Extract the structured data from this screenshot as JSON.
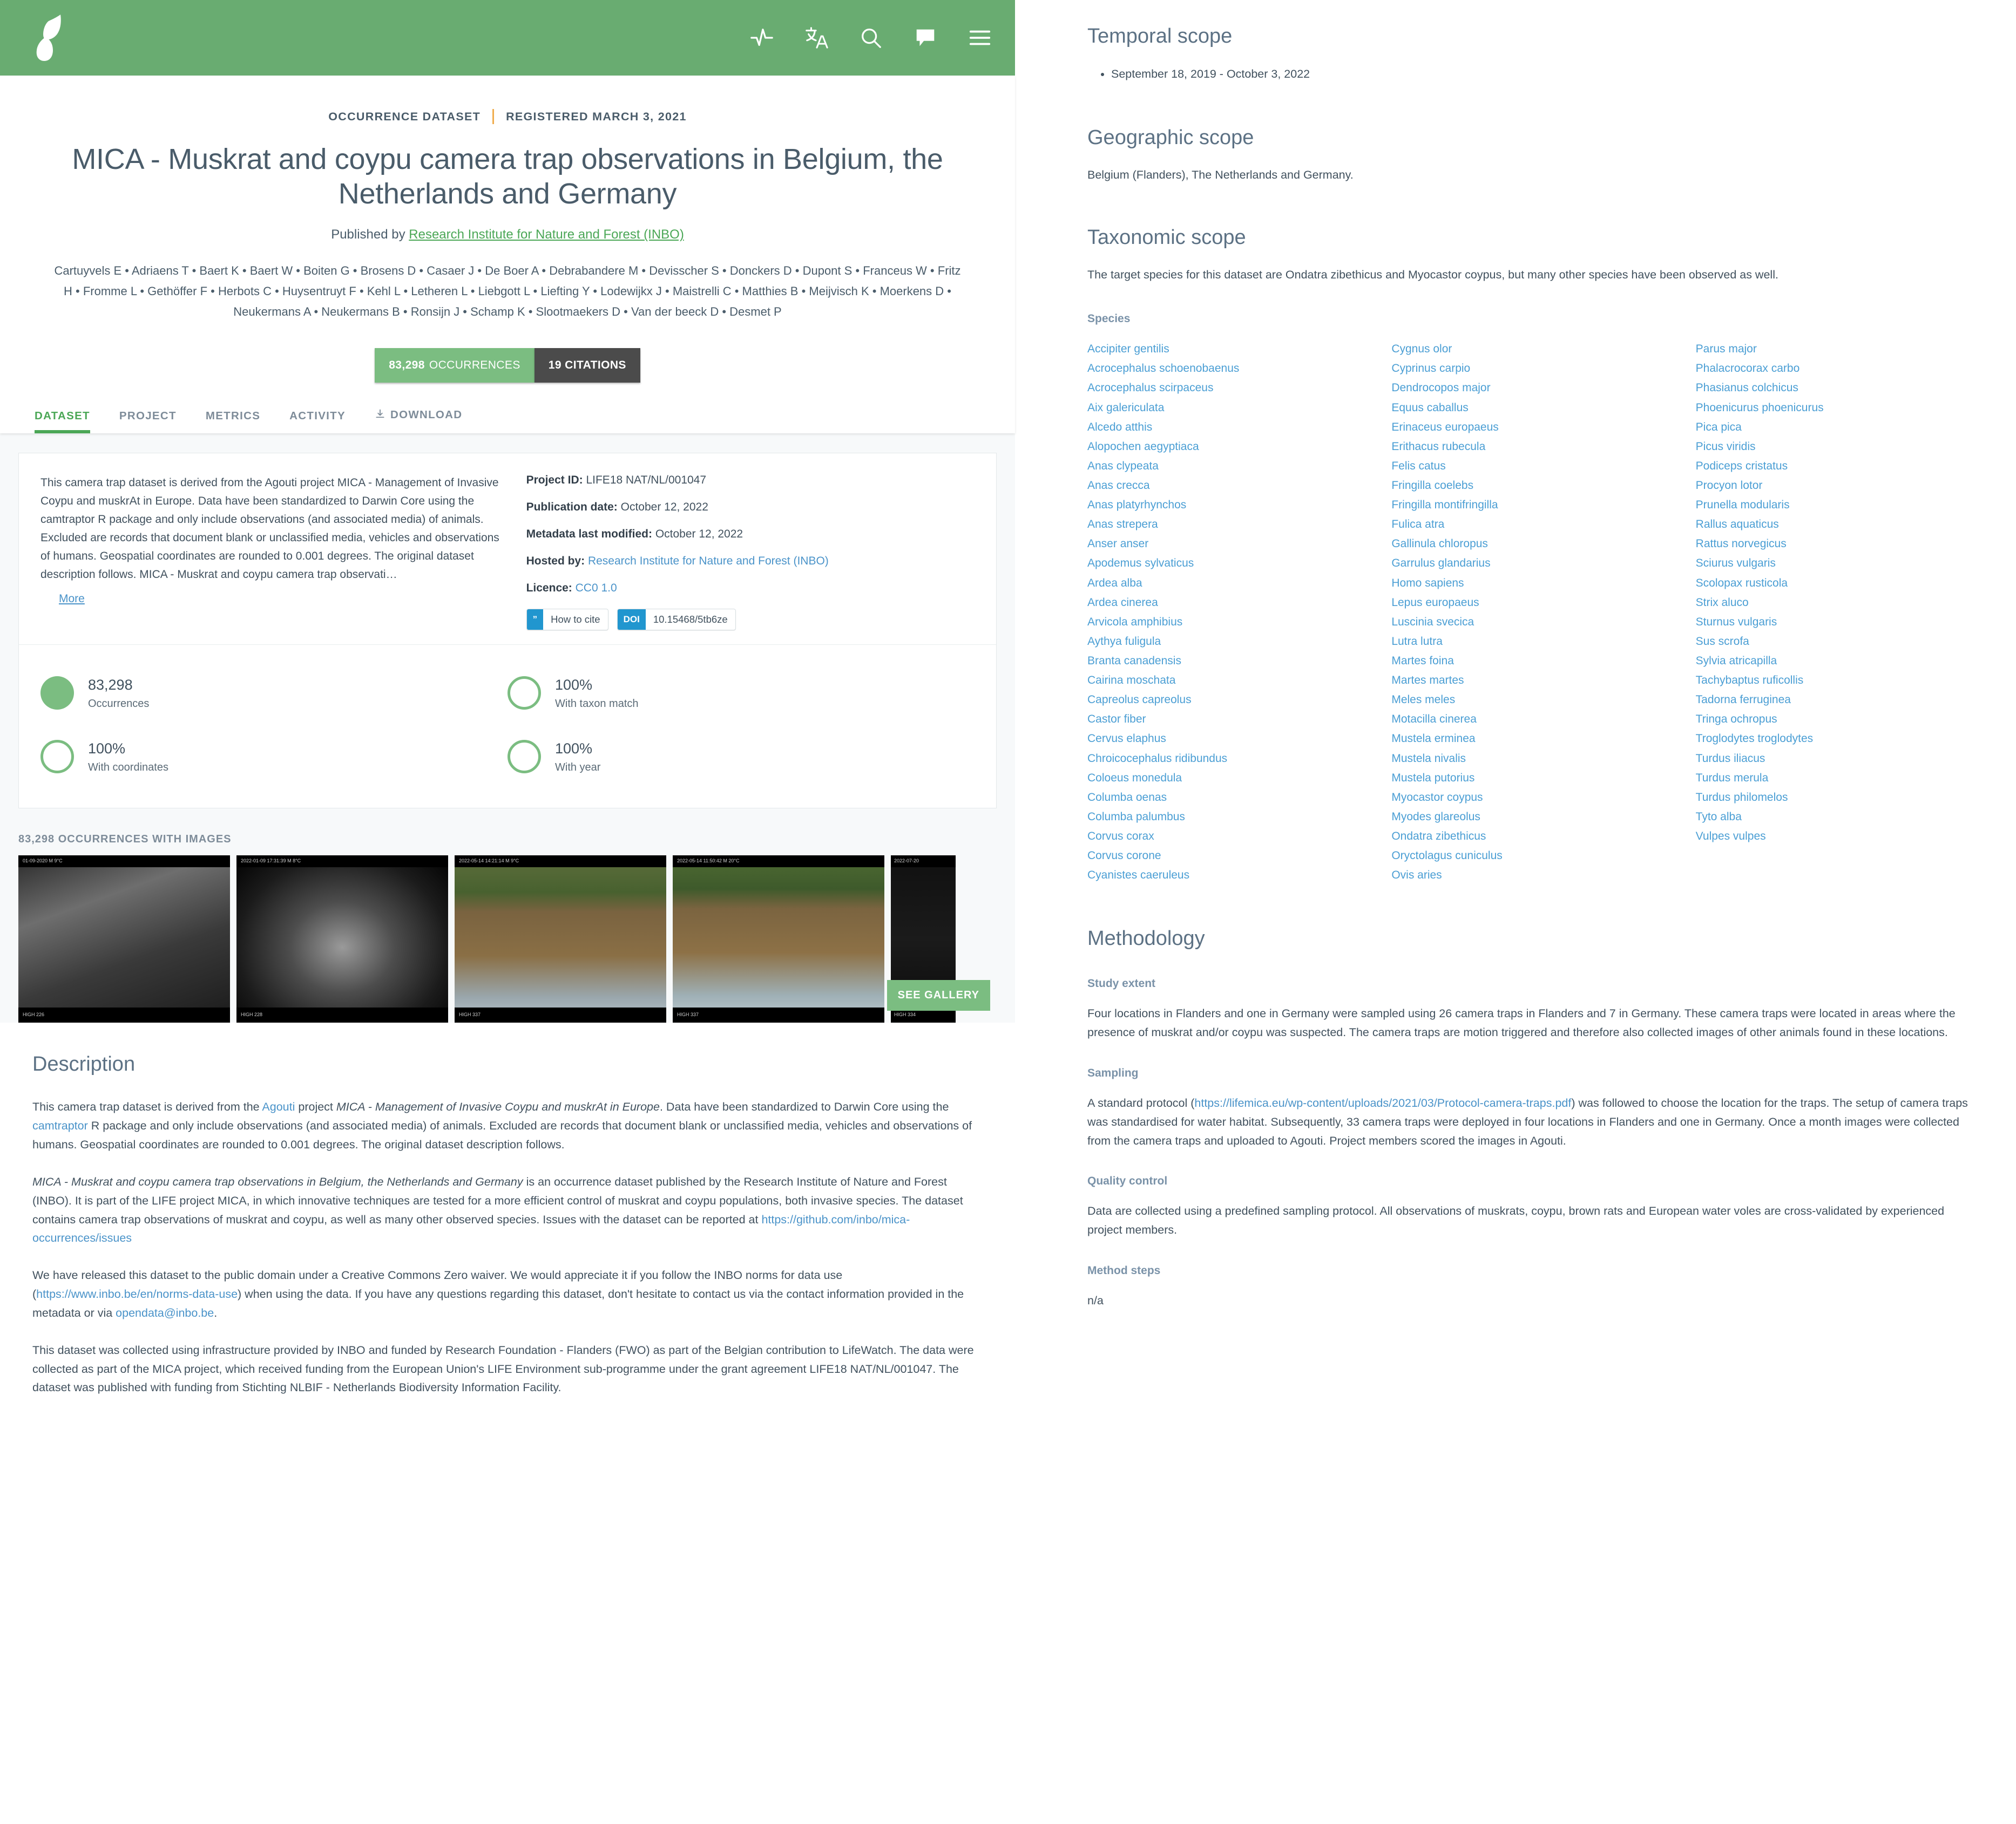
{
  "header": {
    "logo_name": "gbif-logo",
    "icons": [
      {
        "name": "activity-pulse-icon",
        "glyph": "pulse"
      },
      {
        "name": "translate-icon",
        "glyph": "translate"
      },
      {
        "name": "search-icon",
        "glyph": "search"
      },
      {
        "name": "feedback-chat-icon",
        "glyph": "chat"
      },
      {
        "name": "hamburger-menu-icon",
        "glyph": "menu"
      }
    ],
    "accent_green": "#69ac71"
  },
  "hero": {
    "eyebrow_type": "OCCURRENCE DATASET",
    "eyebrow_registered": "REGISTERED MARCH 3, 2021",
    "title": "MICA - Muskrat and coypu camera trap observations in Belgium, the Netherlands and Germany",
    "published_prefix": "Published by ",
    "publisher": "Research Institute for Nature and Forest (INBO)",
    "authors": "Cartuyvels E • Adriaens T • Baert K • Baert W • Boiten G • Brosens D • Casaer J • De Boer A • Debrabandere M • Devisscher S • Donckers D • Dupont S • Franceus W • Fritz H • Fromme L • Gethöffer F • Herbots C • Huysentruyt F • Kehl L • Letheren L • Liebgott L • Liefting Y • Lodewijkx J • Maistrelli C • Matthies B • Meijvisch K • Moerkens D • Neukermans A • Neukermans B • Ronsijn J • Schamp K • Slootmaekers D • Van der beeck D • Desmet P",
    "badge_occurrences_count": "83,298",
    "badge_occurrences_label": "OCCURRENCES",
    "badge_citations": "19 CITATIONS"
  },
  "tabs": [
    {
      "label": "DATASET",
      "active": true
    },
    {
      "label": "PROJECT",
      "active": false
    },
    {
      "label": "METRICS",
      "active": false
    },
    {
      "label": "ACTIVITY",
      "active": false
    },
    {
      "label": "DOWNLOAD",
      "active": false,
      "icon": "download-icon"
    }
  ],
  "summary_card": {
    "short_description": "This camera trap dataset is derived from the Agouti project MICA - Management of Invasive Coypu and muskrAt in Europe. Data have been standardized to Darwin Core using the camtraptor R package and only include observations (and associated media) of animals. Excluded are records that document blank or unclassified media, vehicles and observations of humans. Geospatial coordinates are rounded to 0.001 degrees. The original dataset description follows. MICA - Muskrat and coypu camera trap observati…",
    "more_label": "More",
    "project_id_key": "Project ID:",
    "project_id_value": "LIFE18 NAT/NL/001047",
    "publication_date_key": "Publication date:",
    "publication_date_value": "October 12, 2022",
    "metadata_modified_key": "Metadata last modified:",
    "metadata_modified_value": "October 12, 2022",
    "hosted_by_key": "Hosted by:",
    "hosted_by_value": "Research Institute for Nature and Forest (INBO)",
    "licence_key": "Licence:",
    "licence_value": "CC0 1.0",
    "how_to_cite_label": "How to cite",
    "how_to_cite_icon": "”",
    "doi_label": "DOI",
    "doi_value": "10.15468/5tb6ze"
  },
  "stats": [
    {
      "name": "occurrences",
      "value": "83,298",
      "label": "Occurrences",
      "style": "fill"
    },
    {
      "name": "taxon-match",
      "value": "100%",
      "label": "With taxon match",
      "style": "ring"
    },
    {
      "name": "coordinates",
      "value": "100%",
      "label": "With coordinates",
      "style": "ring"
    },
    {
      "name": "year",
      "value": "100%",
      "label": "With year",
      "style": "ring"
    }
  ],
  "gallery": {
    "heading": "83,298 OCCURRENCES WITH IMAGES",
    "see_gallery_label": "SEE GALLERY",
    "images": [
      {
        "name": "camera-trap-thumb-1",
        "top_stamp": "01-09-2020        M 9°C",
        "bottom_stamp": "HIGH  226",
        "tone": "gray1"
      },
      {
        "name": "camera-trap-thumb-2",
        "top_stamp": "2022-01-09  17:31:39        M 8°C",
        "bottom_stamp": "HIGH  228",
        "tone": "gray2"
      },
      {
        "name": "camera-trap-thumb-3",
        "top_stamp": "2022-05-14  14:21:14        M 9°C",
        "bottom_stamp": "HIGH  337",
        "tone": "water1"
      },
      {
        "name": "camera-trap-thumb-4",
        "top_stamp": "2022-05-14  11:50:42        M 20°C",
        "bottom_stamp": "HIGH  337",
        "tone": "water2"
      },
      {
        "name": "camera-trap-thumb-5",
        "top_stamp": "2022-07-20",
        "bottom_stamp": "HIGH  334",
        "tone": "dark"
      }
    ]
  },
  "description": {
    "heading": "Description",
    "p1_a": "This camera trap dataset is derived from the ",
    "p1_link1": "Agouti",
    "p1_b": " project ",
    "p1_i1": "MICA - Management of Invasive Coypu and muskrAt in Europe",
    "p1_c": ". Data have been standardized to Darwin Core using the ",
    "p1_link2": "camtraptor",
    "p1_d": " R package and only include observations (and associated media) of animals. Excluded are records that document blank or unclassified media, vehicles and observations of humans. Geospatial coordinates are rounded to 0.001 degrees. The original dataset description follows.",
    "p2_i1": "MICA - Muskrat and coypu camera trap observations in Belgium, the Netherlands and Germany",
    "p2_a": " is an occurrence dataset published by the Research Institute of Nature and Forest (INBO). It is part of the LIFE project MICA, in which innovative techniques are tested for a more efficient control of muskrat and coypu populations, both invasive species. The dataset contains camera trap observations of muskrat and coypu, as well as many other observed species. Issues with the dataset can be reported at ",
    "p2_link": "https://github.com/inbo/mica-occurrences/issues",
    "p3_a": "We have released this dataset to the public domain under a Creative Commons Zero waiver. We would appreciate it if you follow the INBO norms for data use (",
    "p3_link1": "https://www.inbo.be/en/norms-data-use",
    "p3_b": ") when using the data. If you have any questions regarding this dataset, don't hesitate to contact us via the contact information provided in the metadata or via ",
    "p3_link2": "opendata@inbo.be",
    "p3_c": ".",
    "p4": "This dataset was collected using infrastructure provided by INBO and funded by Research Foundation - Flanders (FWO) as part of the Belgian contribution to LifeWatch. The data were collected as part of the MICA project, which received funding from the European Union's LIFE Environment sub-programme under the grant agreement LIFE18 NAT/NL/001047. The dataset was published with funding from Stichting NLBIF - Netherlands Biodiversity Information Facility."
  },
  "temporal_scope": {
    "heading": "Temporal scope",
    "items": [
      "September 18, 2019 - October 3, 2022"
    ]
  },
  "geographic_scope": {
    "heading": "Geographic scope",
    "text": "Belgium (Flanders), The Netherlands and Germany."
  },
  "taxonomic_scope": {
    "heading": "Taxonomic scope",
    "text": "The target species for this dataset are Ondatra zibethicus and Myocastor coypus, but many other species have been observed as well.",
    "species_label": "Species",
    "species": [
      "Accipiter gentilis",
      "Acrocephalus schoenobaenus",
      "Acrocephalus scirpaceus",
      "Aix galericulata",
      "Alcedo atthis",
      "Alopochen aegyptiaca",
      "Anas clypeata",
      "Anas crecca",
      "Anas platyrhynchos",
      "Anas strepera",
      "Anser anser",
      "Apodemus sylvaticus",
      "Ardea alba",
      "Ardea cinerea",
      "Arvicola amphibius",
      "Aythya fuligula",
      "Branta canadensis",
      "Cairina moschata",
      "Capreolus capreolus",
      "Castor fiber",
      "Cervus elaphus",
      "Chroicocephalus ridibundus",
      "Coloeus monedula",
      "Columba oenas",
      "Columba palumbus",
      "Corvus corax",
      "Corvus corone",
      "Cyanistes caeruleus",
      "Cygnus olor",
      "Cyprinus carpio",
      "Dendrocopos major",
      "Equus caballus",
      "Erinaceus europaeus",
      "Erithacus rubecula",
      "Felis catus",
      "Fringilla coelebs",
      "Fringilla montifringilla",
      "Fulica atra",
      "Gallinula chloropus",
      "Garrulus glandarius",
      "Homo sapiens",
      "Lepus europaeus",
      "Luscinia svecica",
      "Lutra lutra",
      "Martes foina",
      "Martes martes",
      "Meles meles",
      "Motacilla cinerea",
      "Mustela erminea",
      "Mustela nivalis",
      "Mustela putorius",
      "Myocastor coypus",
      "Myodes glareolus",
      "Ondatra zibethicus",
      "Oryctolagus cuniculus",
      "Ovis aries",
      "Parus major",
      "Phalacrocorax carbo",
      "Phasianus colchicus",
      "Phoenicurus phoenicurus",
      "Pica pica",
      "Picus viridis",
      "Podiceps cristatus",
      "Procyon lotor",
      "Prunella modularis",
      "Rallus aquaticus",
      "Rattus norvegicus",
      "Sciurus vulgaris",
      "Scolopax rusticola",
      "Strix aluco",
      "Sturnus vulgaris",
      "Sus scrofa",
      "Sylvia atricapilla",
      "Tachybaptus ruficollis",
      "Tadorna ferruginea",
      "Tringa ochropus",
      "Troglodytes troglodytes",
      "Turdus iliacus",
      "Turdus merula",
      "Turdus philomelos",
      "Tyto alba",
      "Vulpes vulpes"
    ]
  },
  "methodology": {
    "heading": "Methodology",
    "study_extent_label": "Study extent",
    "study_extent_text": "Four locations in Flanders and one in Germany were sampled using 26 camera traps in Flanders and 7 in Germany. These camera traps were located in areas where the presence of muskrat and/or coypu was suspected. The camera traps are motion triggered and therefore also collected images of other animals found in these locations.",
    "sampling_label": "Sampling",
    "sampling_a": "A standard protocol (",
    "sampling_link": "https://lifemica.eu/wp-content/uploads/2021/03/Protocol-camera-traps.pdf",
    "sampling_b": ") was followed to choose the location for the traps. The setup of camera traps was standardised for water habitat. Subsequently, 33 camera traps were deployed in four locations in Flanders and one in Germany. Once a month images were collected from the camera traps and uploaded to Agouti. Project members scored the images in Agouti.",
    "quality_control_label": "Quality control",
    "quality_control_text": "Data are collected using a predefined sampling protocol. All observations of muskrats, coypu, brown rats and European water voles are cross-validated by experienced project members.",
    "method_steps_label": "Method steps",
    "method_steps_text": "n/a"
  }
}
